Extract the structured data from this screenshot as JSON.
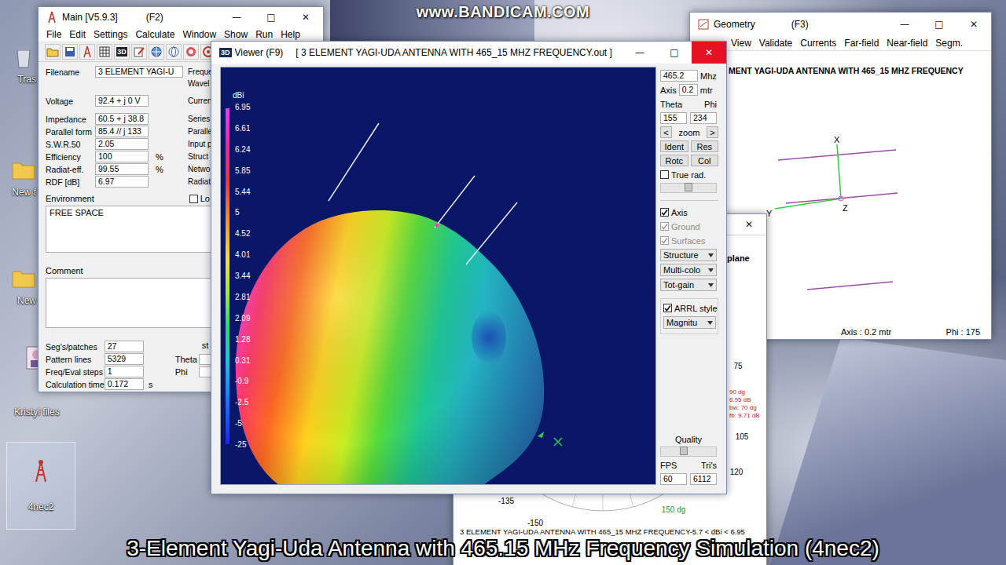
{
  "desktop": {
    "watermark": "www.BANDICAM.COM",
    "caption": "3-Element Yagi-Uda Antenna with 465.15 MHz Frequency Simulation (4nec2)",
    "icons": [
      {
        "label": "Tras",
        "kind": "recycle",
        "selected": false
      },
      {
        "label": "New f",
        "kind": "folder",
        "selected": false
      },
      {
        "label": "New",
        "kind": "folder",
        "selected": false
      },
      {
        "label": "Kristyl files",
        "kind": "picture",
        "selected": false
      },
      {
        "label": "4nec2",
        "kind": "app",
        "selected": true
      }
    ]
  },
  "main_window": {
    "title": "Main [V5.9.3]",
    "hotkey": "(F2)",
    "controls": [
      "—",
      "□",
      "✕"
    ],
    "menu": [
      "File",
      "Edit",
      "Settings",
      "Calculate",
      "Window",
      "Show",
      "Run",
      "Help"
    ],
    "toolbar": [
      {
        "kind": "folder"
      },
      {
        "kind": "save"
      },
      {
        "kind": "tower"
      },
      {
        "kind": "grid"
      },
      {
        "kind": "label",
        "label": "3D"
      },
      {
        "kind": "edit"
      },
      {
        "kind": "globe"
      },
      {
        "kind": "pattern"
      },
      {
        "kind": "target"
      },
      {
        "kind": "ring"
      },
      {
        "kind": "pen"
      }
    ],
    "filename": {
      "label": "Filename",
      "value": "3 ELEMENT YAGI-U",
      "side": "Freque"
    },
    "filename_side2": "Wavel",
    "results": [
      {
        "label": "Voltage",
        "value": "92.4 + j 0 V",
        "unit": "",
        "side": "Curren"
      },
      {
        "label": "Impedance",
        "value": "60.5 + j 38.8",
        "unit": "",
        "side": "Series"
      },
      {
        "label": "Parallel form",
        "value": "85.4 // j 133",
        "unit": "",
        "side": "Paralle"
      },
      {
        "label": "S.W.R.50",
        "value": "2.05",
        "unit": "",
        "side": "Input p"
      },
      {
        "label": "Efficiency",
        "value": "100",
        "unit": "%",
        "side": "Struct"
      },
      {
        "label": "Radiat-eff.",
        "value": "99.55",
        "unit": "%",
        "side": "Netwo"
      },
      {
        "label": "RDF [dB]",
        "value": "6.97",
        "unit": "",
        "side": "Radiat"
      }
    ],
    "environment": {
      "label": "Environment",
      "option": {
        "label": "Lo",
        "checked": false
      },
      "text": "FREE SPACE"
    },
    "comment": {
      "label": "Comment",
      "text": ""
    },
    "stats": [
      {
        "label": "Seg's/patches",
        "value": "27",
        "unit": ""
      },
      {
        "label": "Pattern lines",
        "value": "5329",
        "unit": ""
      },
      {
        "label": "Freq/Eval steps",
        "value": "1",
        "unit": ""
      },
      {
        "label": "Calculation time",
        "value": "0.172",
        "unit": "s"
      }
    ],
    "angles": {
      "label": "st",
      "theta": "Theta",
      "phi": "Phi"
    }
  },
  "viewer": {
    "title_icon": "3D",
    "title": "Viewer  (F9)",
    "file": "[ 3 ELEMENT YAGI-UDA ANTENNA WITH 465_15 MHZ FREQUENCY.out ]",
    "controls": [
      "—",
      "□",
      "✕"
    ],
    "legend": {
      "unit": "dBi",
      "ticks": [
        "6.95",
        "6.61",
        "6.24",
        "5.85",
        "5.44",
        "5",
        "4.52",
        "4.01",
        "3.44",
        "2.81",
        "2.09",
        "1.28",
        "0.31",
        "-0.9",
        "-2.5",
        "-5",
        "-25"
      ]
    },
    "panel": {
      "frequency": {
        "value": "465.2",
        "unit": "Mhz"
      },
      "axis": {
        "label": "Axis",
        "value": "0.2",
        "unit": "mtr"
      },
      "theta": {
        "label": "Theta",
        "value": "155"
      },
      "phi": {
        "label": "Phi",
        "value": "234"
      },
      "zoom": {
        "prev": "<",
        "label": "zoom",
        "next": ">"
      },
      "buttons": [
        "Ident",
        "Res",
        "Rotc",
        "Col"
      ],
      "true_rad": {
        "label": "True rad.",
        "checked": false
      },
      "rotation_slider": {
        "level": 0.5
      },
      "toggles": [
        {
          "label": "Axis",
          "checked": true,
          "disabled": false
        },
        {
          "label": "Ground",
          "checked": true,
          "disabled": true
        },
        {
          "label": "Surfaces",
          "checked": true,
          "disabled": true
        }
      ],
      "dropdowns": [
        "Structure",
        "Multi-colo",
        "Tot-gain"
      ],
      "arrl": {
        "label": "ARRL style",
        "checked": true
      },
      "arrl_dropdown": "Magnitu",
      "quality": {
        "label": "Quality",
        "level": 0.4
      },
      "fps": {
        "label": "FPS",
        "value": "60"
      },
      "tris": {
        "label": "Tri's",
        "value": "6112"
      }
    }
  },
  "geometry": {
    "title": "Geometry",
    "hotkey": "(F3)",
    "controls": [
      "—",
      "□",
      "✕"
    ],
    "menu": [
      "View",
      "Validate",
      "Currents",
      "Far-field",
      "Near-field",
      "Segm."
    ],
    "heading": "MENT YAGI-UDA ANTENNA WITH 465_15 MHZ FREQUENCY",
    "axes": [
      "X",
      "Y",
      "Z"
    ],
    "footer": {
      "axis": "Axis : 0.2 mtr",
      "phi": "Phi : 175"
    }
  },
  "polar": {
    "close": "✕",
    "plane": "plane",
    "angle_labels": [
      {
        "text": "75",
        "color": "#000000"
      },
      {
        "text": "105",
        "color": "#000000"
      },
      {
        "text": "120",
        "color": "#000000"
      },
      {
        "text": "150 dg",
        "color": "#1a9a1a"
      },
      {
        "text": "-150",
        "color": "#000000"
      },
      {
        "text": "-135",
        "color": "#000000"
      }
    ],
    "readouts": [
      "90 dg",
      "6.95 dB",
      "bw: 70 dg",
      "fb: 9.71 dB"
    ],
    "footer": "3 ELEMENT YAGI-UDA ANTENNA WITH 465_15 MHZ FREQUENCY-5.7 < dBi < 6.95"
  }
}
